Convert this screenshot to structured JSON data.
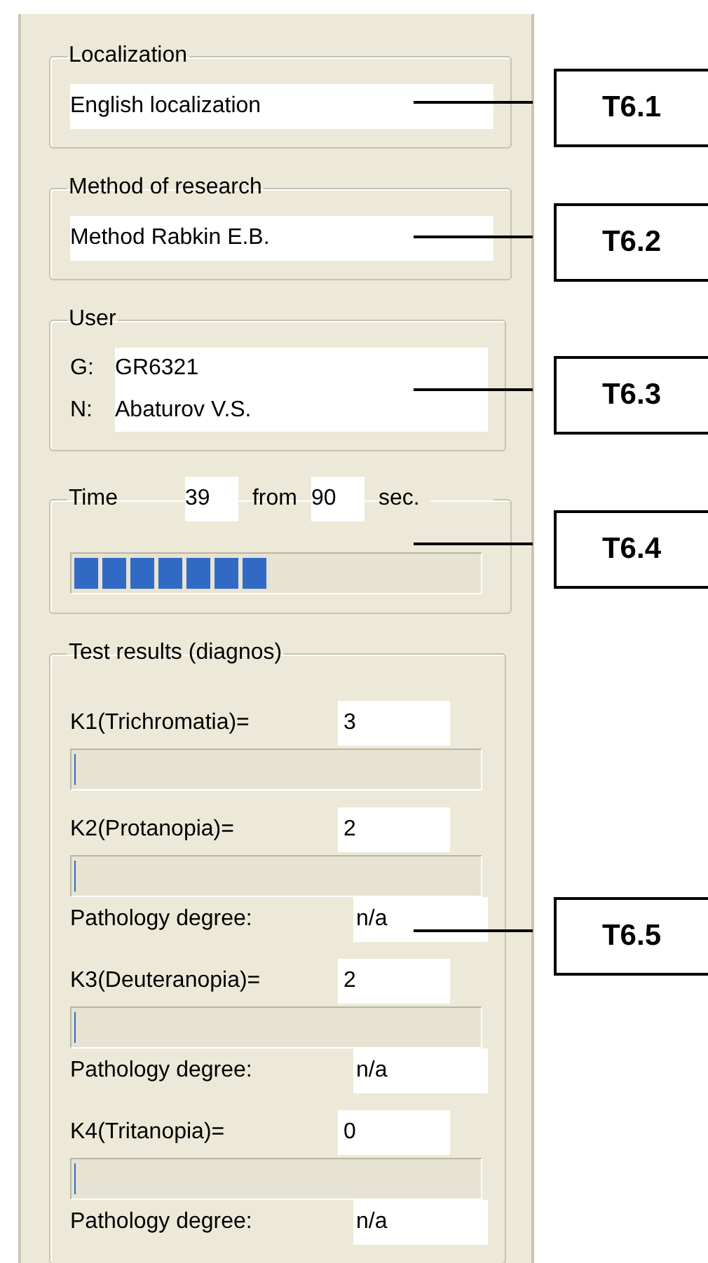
{
  "localization": {
    "title": "Localization",
    "value": "English localization"
  },
  "method": {
    "title": "Method of research",
    "value": "Method Rabkin E.B."
  },
  "user": {
    "title": "User",
    "rows": [
      {
        "label": "G:",
        "value": "GR6321"
      },
      {
        "label": "N:",
        "value": "Abaturov V.S."
      }
    ]
  },
  "time": {
    "label": "Time",
    "elapsed": "39",
    "from": "from",
    "total": "90",
    "unit": "sec.",
    "level": 0.47
  },
  "results": {
    "title": "Test results (diagnos)",
    "items": [
      {
        "label": "K1(Trichromatia)=",
        "value": "3",
        "level": 0
      },
      {
        "label": "K2(Protanopia)=",
        "value": "2",
        "level": 0,
        "pathology_label": "Pathology degree:",
        "pathology_value": "n/a"
      },
      {
        "label": "K3(Deuteranopia)=",
        "value": "2",
        "level": 0,
        "pathology_label": "Pathology degree:",
        "pathology_value": "n/a"
      },
      {
        "label": "K4(Tritanopia)=",
        "value": "0",
        "level": 0,
        "pathology_label": "Pathology degree:",
        "pathology_value": "n/a"
      }
    ]
  },
  "callouts": [
    "T6.1",
    "T6.2",
    "T6.3",
    "T6.4",
    "T6.5"
  ]
}
